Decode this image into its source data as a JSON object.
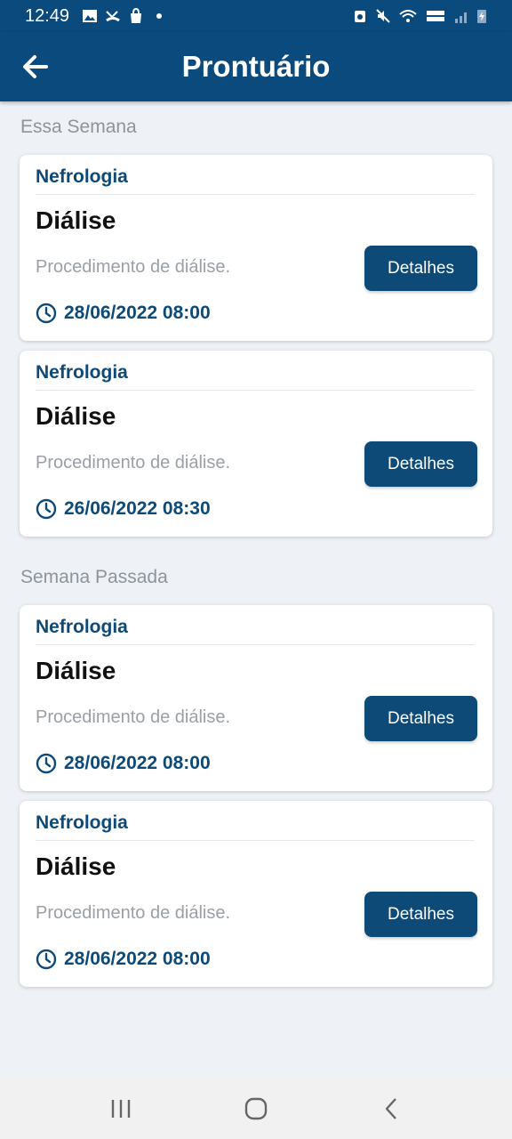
{
  "status_bar": {
    "time": "12:49",
    "icons": [
      "image-icon",
      "missed-call-icon",
      "shopping-bag-icon",
      "dot-icon",
      "alarm-icon",
      "mute-icon",
      "wifi-icon",
      "volte-icon",
      "signal-icon",
      "battery-charging-icon"
    ]
  },
  "app_bar": {
    "title": "Prontuário",
    "back_icon": "arrow-left-icon"
  },
  "sections": [
    {
      "title": "Essa Semana",
      "cards": [
        {
          "category": "Nefrologia",
          "title": "Diálise",
          "description": "Procedimento de diálise.",
          "datetime": "28/06/2022 08:00",
          "button_label": "Detalhes"
        },
        {
          "category": "Nefrologia",
          "title": "Diálise",
          "description": "Procedimento de diálise.",
          "datetime": "26/06/2022 08:30",
          "button_label": "Detalhes"
        }
      ]
    },
    {
      "title": "Semana Passada",
      "cards": [
        {
          "category": "Nefrologia",
          "title": "Diálise",
          "description": "Procedimento de diálise.",
          "datetime": "28/06/2022 08:00",
          "button_label": "Detalhes"
        },
        {
          "category": "Nefrologia",
          "title": "Diálise",
          "description": "Procedimento de diálise.",
          "datetime": "28/06/2022 08:00",
          "button_label": "Detalhes"
        }
      ]
    }
  ],
  "nav_bar": {
    "buttons": [
      "recent-apps-icon",
      "home-icon",
      "back-icon"
    ]
  },
  "colors": {
    "primary": "#0a4a7c",
    "accent_text": "#0d4a78",
    "background": "#eef1f5",
    "muted_text": "#9aa0a6"
  }
}
